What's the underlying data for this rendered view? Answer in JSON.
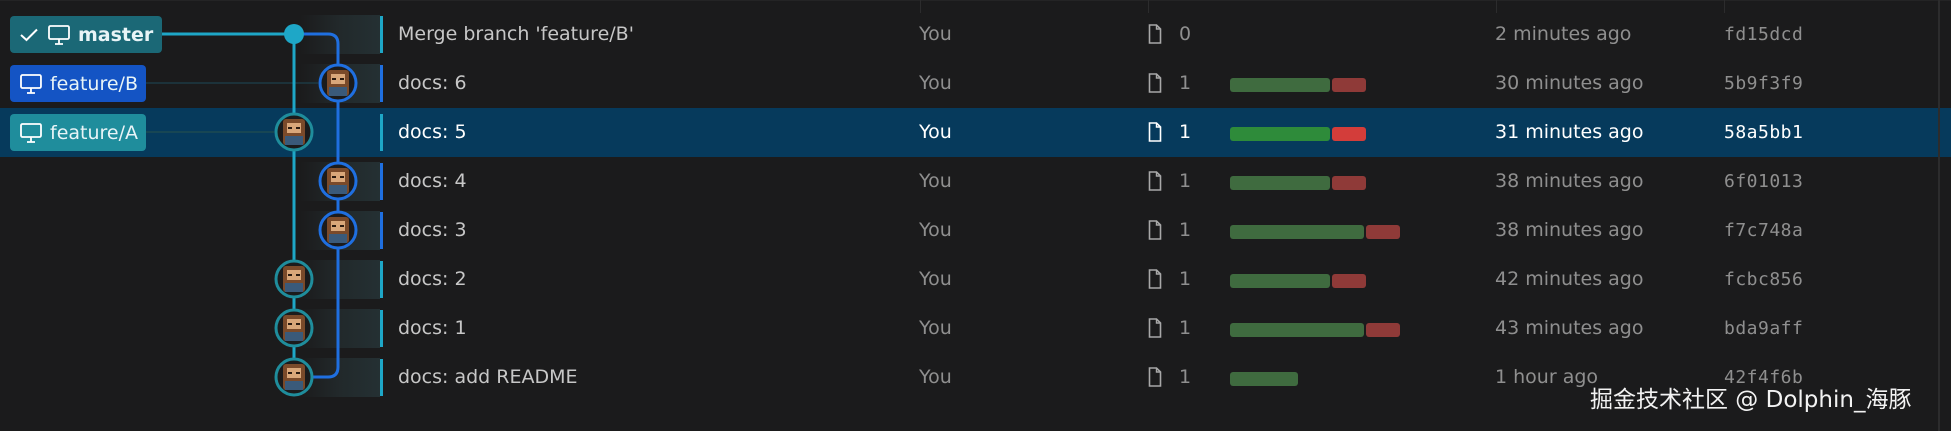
{
  "branches": [
    {
      "name": "master",
      "current": true
    },
    {
      "name": "feature/B",
      "current": false
    },
    {
      "name": "feature/A",
      "current": false
    }
  ],
  "commits": [
    {
      "message": "Merge branch 'feature/B'",
      "author": "You",
      "files": "0",
      "date": "2 minutes ago",
      "sha": "fd15dcd",
      "additions": 0,
      "deletions": 0
    },
    {
      "message": "docs: 6",
      "author": "You",
      "files": "1",
      "date": "30 minutes ago",
      "sha": "5b9f3f9",
      "additions": 3,
      "deletions": 1
    },
    {
      "message": "docs: 5",
      "author": "You",
      "files": "1",
      "date": "31 minutes ago",
      "sha": "58a5bb1",
      "additions": 3,
      "deletions": 1,
      "selected": true
    },
    {
      "message": "docs: 4",
      "author": "You",
      "files": "1",
      "date": "38 minutes ago",
      "sha": "6f01013",
      "additions": 3,
      "deletions": 1
    },
    {
      "message": "docs: 3",
      "author": "You",
      "files": "1",
      "date": "38 minutes ago",
      "sha": "f7c748a",
      "additions": 4,
      "deletions": 1
    },
    {
      "message": "docs: 2",
      "author": "You",
      "files": "1",
      "date": "42 minutes ago",
      "sha": "fcbc856",
      "additions": 3,
      "deletions": 1
    },
    {
      "message": "docs: 1",
      "author": "You",
      "files": "1",
      "date": "43 minutes ago",
      "sha": "bda9aff",
      "additions": 4,
      "deletions": 1
    },
    {
      "message": "docs: add README",
      "author": "You",
      "files": "1",
      "date": "1 hour ago",
      "sha": "42f4f6b",
      "additions": 2,
      "deletions": 0
    }
  ],
  "watermark": "掘金技术社区 @ Dolphin_海豚",
  "colors": {
    "selected_row": "#063a5c",
    "lane_master": "#1ea7c7",
    "lane_feature_b": "#1f6fe0",
    "lane_feature_a": "#1f8d9c",
    "additions": "#3f6b3f",
    "deletions": "#8f3a38"
  }
}
